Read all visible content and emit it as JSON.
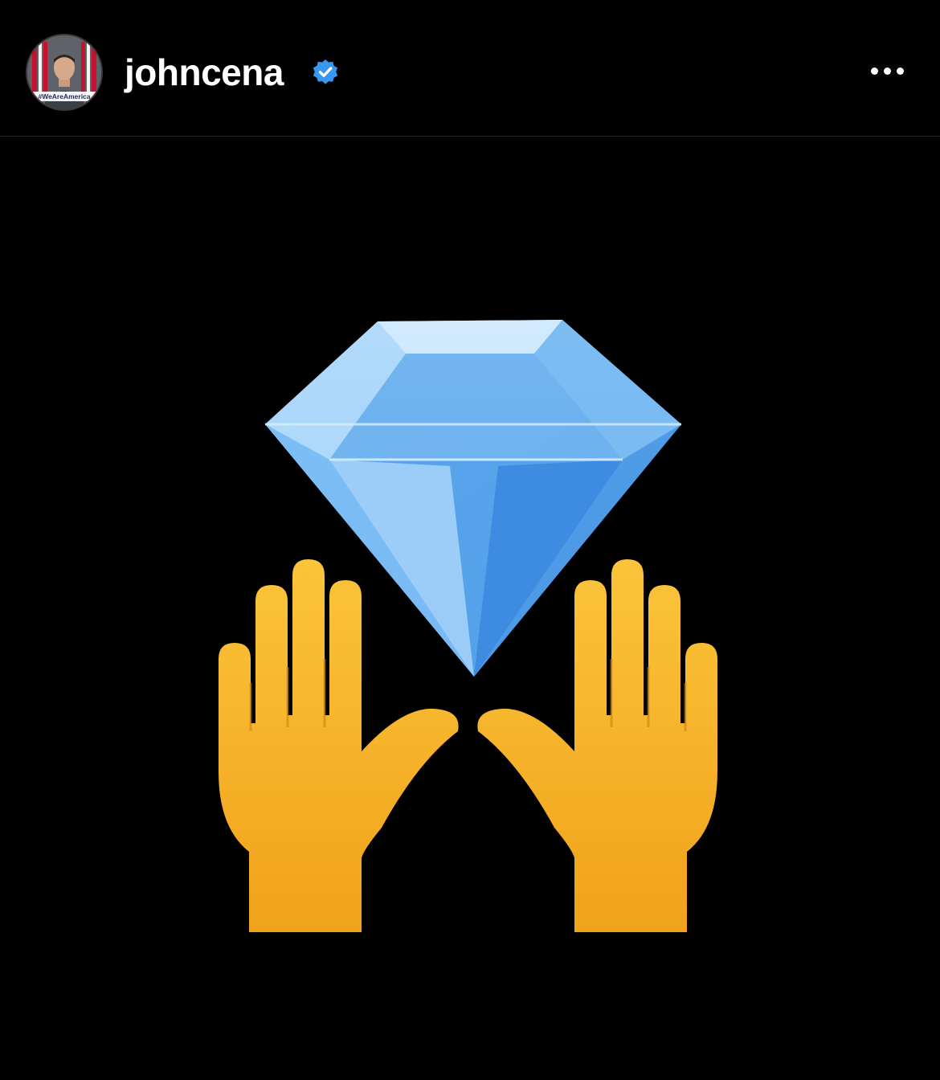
{
  "post": {
    "username": "johncena",
    "verified": true,
    "avatar": {
      "icon": "profile-photo",
      "badge_text": "#WeAreAmerica"
    },
    "more_icon": "more-horizontal-icon",
    "image": {
      "content": [
        "gem-stone-emoji",
        "raising-hands-emoji"
      ]
    }
  },
  "colors": {
    "background": "#000000",
    "verified_badge": "#3897f0",
    "diamond": "#6fb6f2",
    "hands": "#f7b52a"
  }
}
